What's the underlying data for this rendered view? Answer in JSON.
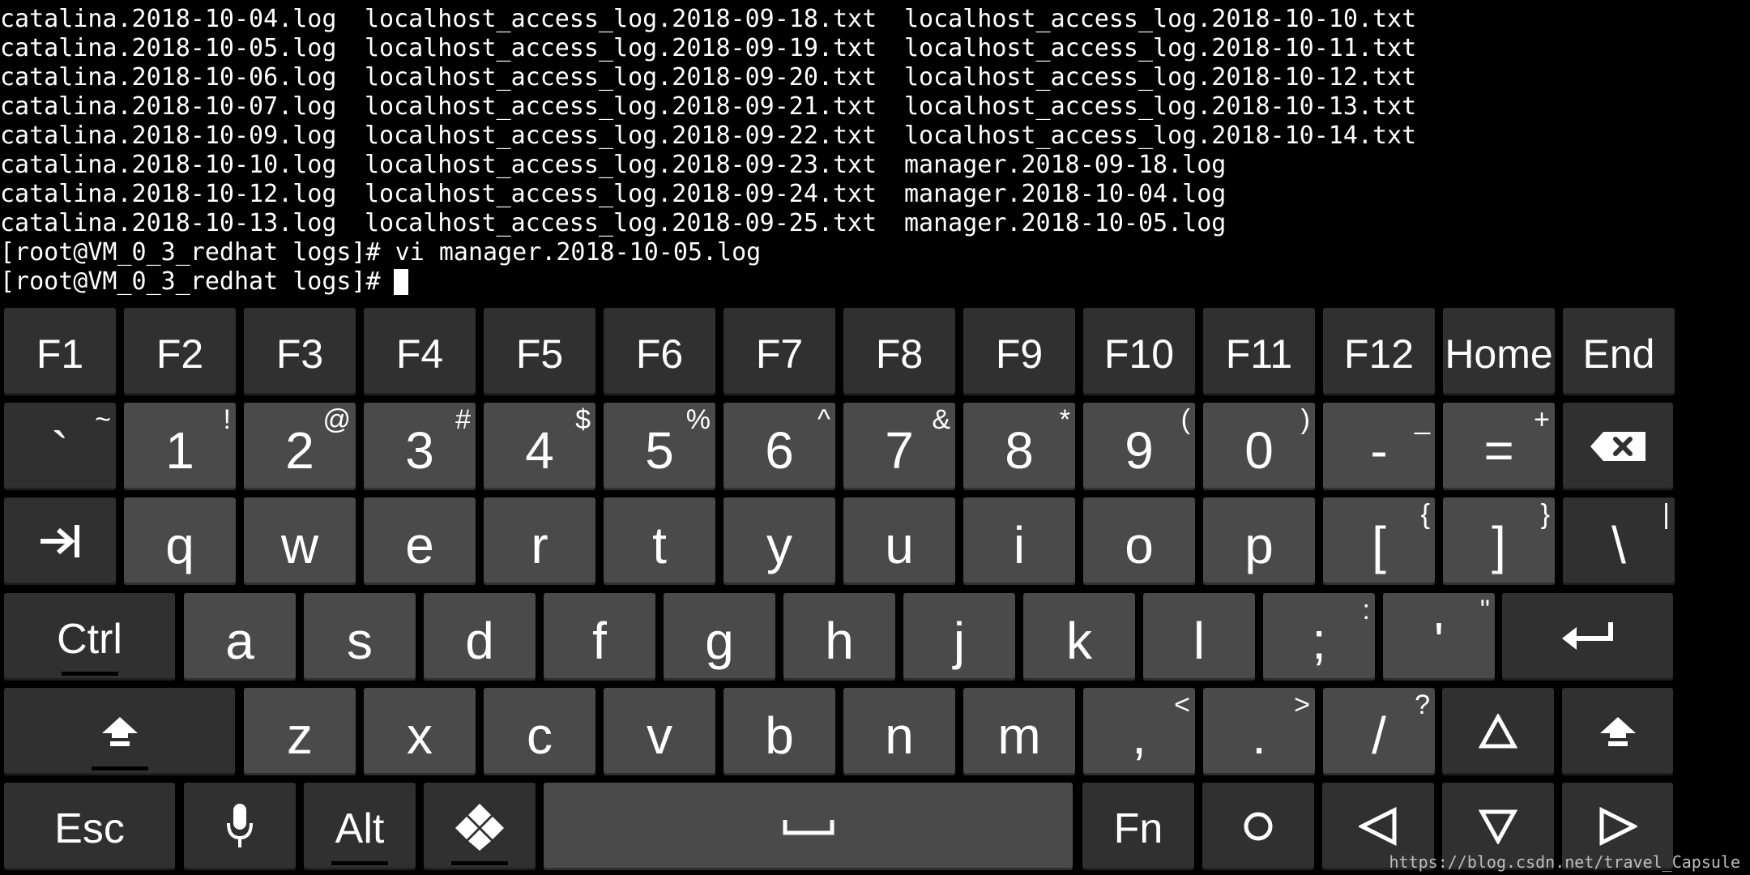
{
  "terminal": {
    "rows": [
      [
        "catalina.2018-10-04.log",
        "localhost_access_log.2018-09-18.txt",
        "localhost_access_log.2018-10-10.txt"
      ],
      [
        "catalina.2018-10-05.log",
        "localhost_access_log.2018-09-19.txt",
        "localhost_access_log.2018-10-11.txt"
      ],
      [
        "catalina.2018-10-06.log",
        "localhost_access_log.2018-09-20.txt",
        "localhost_access_log.2018-10-12.txt"
      ],
      [
        "catalina.2018-10-07.log",
        "localhost_access_log.2018-09-21.txt",
        "localhost_access_log.2018-10-13.txt"
      ],
      [
        "catalina.2018-10-09.log",
        "localhost_access_log.2018-09-22.txt",
        "localhost_access_log.2018-10-14.txt"
      ],
      [
        "catalina.2018-10-10.log",
        "localhost_access_log.2018-09-23.txt",
        "manager.2018-09-18.log"
      ],
      [
        "catalina.2018-10-12.log",
        "localhost_access_log.2018-09-24.txt",
        "manager.2018-10-04.log"
      ],
      [
        "catalina.2018-10-13.log",
        "localhost_access_log.2018-09-25.txt",
        "manager.2018-10-05.log"
      ]
    ],
    "command_line": "[root@VM_0_3_redhat logs]# vi manager.2018-10-05.log",
    "prompt_line": "[root@VM_0_3_redhat logs]# "
  },
  "keyboard": {
    "row_fn": [
      "F1",
      "F2",
      "F3",
      "F4",
      "F5",
      "F6",
      "F7",
      "F8",
      "F9",
      "F10",
      "F11",
      "F12",
      "Home",
      "End"
    ],
    "row_num": [
      {
        "main": "`",
        "alt": "~"
      },
      {
        "main": "1",
        "alt": "!"
      },
      {
        "main": "2",
        "alt": "@"
      },
      {
        "main": "3",
        "alt": "#"
      },
      {
        "main": "4",
        "alt": "$"
      },
      {
        "main": "5",
        "alt": "%"
      },
      {
        "main": "6",
        "alt": "^"
      },
      {
        "main": "7",
        "alt": "&"
      },
      {
        "main": "8",
        "alt": "*"
      },
      {
        "main": "9",
        "alt": "("
      },
      {
        "main": "0",
        "alt": ")"
      },
      {
        "main": "-",
        "alt": "_"
      },
      {
        "main": "=",
        "alt": "+"
      }
    ],
    "row_q": [
      {
        "main": "q",
        "alt": ""
      },
      {
        "main": "w",
        "alt": ""
      },
      {
        "main": "e",
        "alt": ""
      },
      {
        "main": "r",
        "alt": ""
      },
      {
        "main": "t",
        "alt": ""
      },
      {
        "main": "y",
        "alt": ""
      },
      {
        "main": "u",
        "alt": ""
      },
      {
        "main": "i",
        "alt": ""
      },
      {
        "main": "o",
        "alt": ""
      },
      {
        "main": "p",
        "alt": ""
      },
      {
        "main": "[",
        "alt": "{"
      },
      {
        "main": "]",
        "alt": "}"
      },
      {
        "main": "\\",
        "alt": "|"
      }
    ],
    "row_a": [
      {
        "main": "a",
        "alt": ""
      },
      {
        "main": "s",
        "alt": ""
      },
      {
        "main": "d",
        "alt": ""
      },
      {
        "main": "f",
        "alt": ""
      },
      {
        "main": "g",
        "alt": ""
      },
      {
        "main": "h",
        "alt": ""
      },
      {
        "main": "j",
        "alt": ""
      },
      {
        "main": "k",
        "alt": ""
      },
      {
        "main": "l",
        "alt": ""
      },
      {
        "main": ";",
        "alt": ":"
      },
      {
        "main": "'",
        "alt": "\""
      }
    ],
    "row_z": [
      {
        "main": "z",
        "alt": ""
      },
      {
        "main": "x",
        "alt": ""
      },
      {
        "main": "c",
        "alt": ""
      },
      {
        "main": "v",
        "alt": ""
      },
      {
        "main": "b",
        "alt": ""
      },
      {
        "main": "n",
        "alt": ""
      },
      {
        "main": "m",
        "alt": ""
      },
      {
        "main": ",",
        "alt": "<"
      },
      {
        "main": ".",
        "alt": ">"
      },
      {
        "main": "/",
        "alt": "?"
      }
    ],
    "ctrl_label": "Ctrl",
    "esc_label": "Esc",
    "alt_label": "Alt",
    "fn_label": "Fn",
    "icons": {
      "tab": "tab-icon",
      "backspace": "backspace-icon",
      "enter": "enter-icon",
      "shift": "shift-icon",
      "mic": "microphone-icon",
      "diamond": "diamond-icon",
      "space": "space-icon",
      "circle": "circle-icon",
      "up": "arrow-up-icon",
      "down": "arrow-down-icon",
      "left": "arrow-left-icon",
      "right": "arrow-right-icon"
    },
    "colors": {
      "key": "#4a4a4a",
      "key_dark": "#303030",
      "background": "#000000",
      "text": "#ffffff"
    }
  },
  "watermark": "https://blog.csdn.net/travel_Capsule"
}
